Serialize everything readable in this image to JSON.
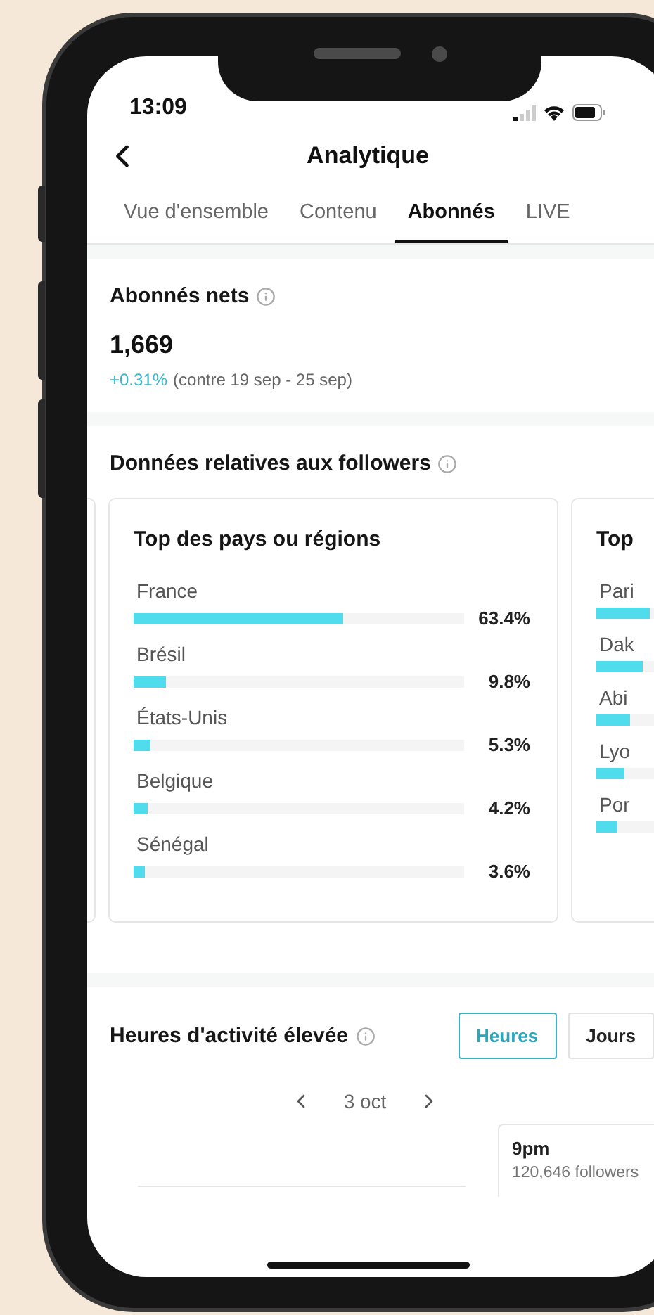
{
  "status_bar": {
    "time": "13:09"
  },
  "header": {
    "title": "Analytique"
  },
  "tabs": [
    {
      "label": "Vue d'ensemble",
      "selected": false
    },
    {
      "label": "Contenu",
      "selected": false
    },
    {
      "label": "Abonnés",
      "selected": true
    },
    {
      "label": "LIVE",
      "selected": false
    }
  ],
  "net_followers": {
    "title": "Abonnés nets",
    "value": "1,669",
    "change": "+0.31%",
    "comparison": "(contre 19 sep - 25 sep)"
  },
  "follower_data": {
    "title": "Données relatives aux followers",
    "cards": [
      {
        "title": "Top des pays ou régions",
        "rows": [
          {
            "label": "France",
            "level": 0.634,
            "reading": "63.4%"
          },
          {
            "label": "Brésil",
            "level": 0.098,
            "reading": "9.8%"
          },
          {
            "label": "États-Unis",
            "level": 0.053,
            "reading": "5.3%"
          },
          {
            "label": "Belgique",
            "level": 0.042,
            "reading": "4.2%"
          },
          {
            "label": "Sénégal",
            "level": 0.036,
            "reading": "3.6%"
          }
        ]
      },
      {
        "title": "Top",
        "rows": [
          {
            "label": "Pari",
            "level": 0.16
          },
          {
            "label": "Dak",
            "level": 0.14
          },
          {
            "label": "Abi",
            "level": 0.1
          },
          {
            "label": "Lyo",
            "level": 0.085
          },
          {
            "label": "Por",
            "level": 0.064
          }
        ]
      }
    ]
  },
  "activity": {
    "title": "Heures d'activité élevée",
    "toggles": [
      {
        "label": "Heures",
        "selected": true
      },
      {
        "label": "Jours",
        "selected": false
      }
    ],
    "date": "3 oct",
    "tooltip": {
      "time": "9pm",
      "value": "120,646 followers"
    }
  }
}
